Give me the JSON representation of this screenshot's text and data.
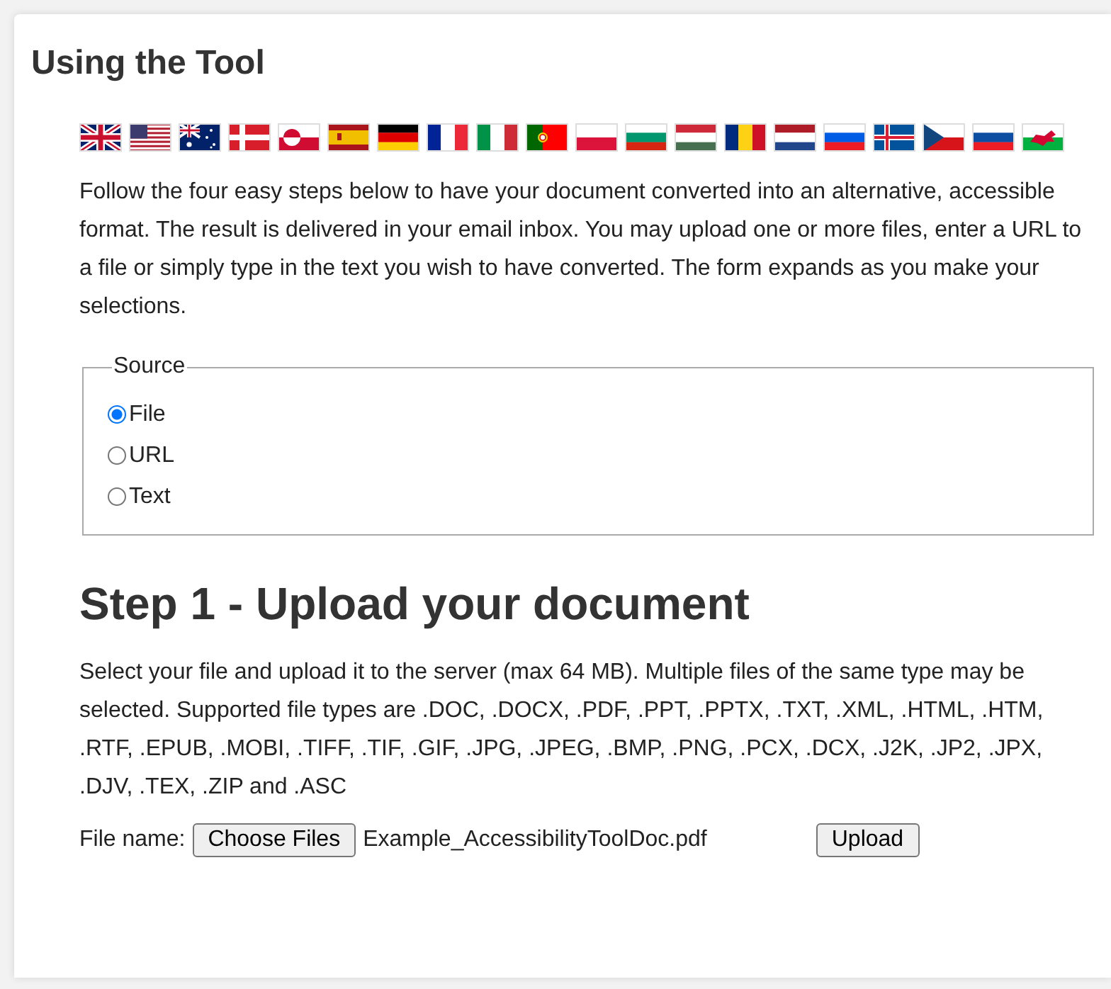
{
  "title": "Using the Tool",
  "intro": "Follow the four easy steps below to have your document converted into an alternative, accessible format. The result is delivered in your email inbox. You may upload one or more files, enter a URL to a file or simply type in the text you wish to have converted. The form expands as you make your selections.",
  "source": {
    "legend": "Source",
    "options": [
      {
        "label": "File",
        "selected": true
      },
      {
        "label": "URL",
        "selected": false
      },
      {
        "label": "Text",
        "selected": false
      }
    ]
  },
  "step": {
    "heading": "Step 1 - Upload your document",
    "description": "Select your file and upload it to the server (max 64 MB). Multiple files of the same type may be selected. Supported file types are .DOC, .DOCX, .PDF, .PPT, .PPTX, .TXT, .XML, .HTML, .HTM, .RTF, .EPUB, .MOBI, .TIFF, .TIF, .GIF, .JPG, .JPEG, .BMP, .PNG, .PCX, .DCX, .J2K, .JP2, .JPX, .DJV, .TEX, .ZIP and .ASC",
    "file_label": "File name:",
    "choose_button": "Choose Files",
    "file_name": "Example_AccessibilityToolDoc.pdf",
    "upload_button": "Upload"
  }
}
